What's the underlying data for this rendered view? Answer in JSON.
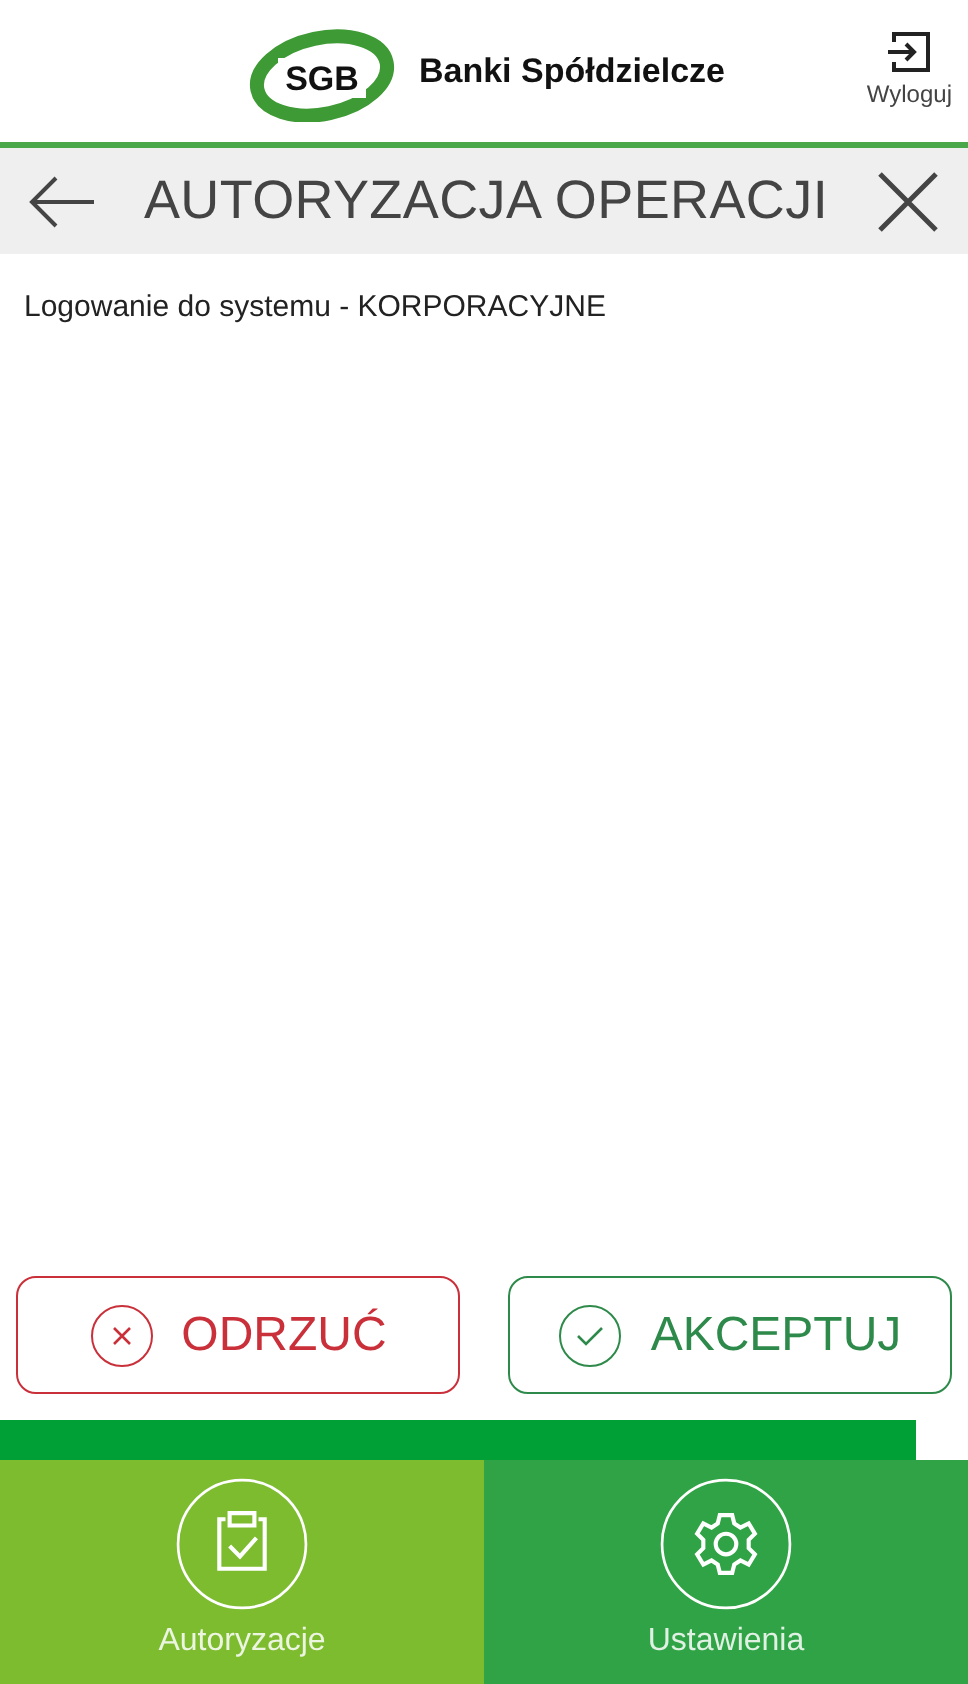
{
  "header": {
    "logo_mark": "SGB",
    "brand": "Banki Spółdzielcze",
    "logout_label": "Wyloguj"
  },
  "title_bar": {
    "title": "AUTORYZACJA OPERACJI"
  },
  "operation": {
    "description": "Logowanie do systemu - KORPORACYJNE"
  },
  "actions": [
    {
      "kind": "reject",
      "label": "ODRZUĆ"
    },
    {
      "kind": "accept",
      "label": "AKCEPTUJ"
    }
  ],
  "bottom_nav": [
    {
      "kind": "authorizations",
      "label": "Autoryzacje",
      "selected": true
    },
    {
      "kind": "settings",
      "label": "Ustawienia",
      "selected": false
    }
  ]
}
